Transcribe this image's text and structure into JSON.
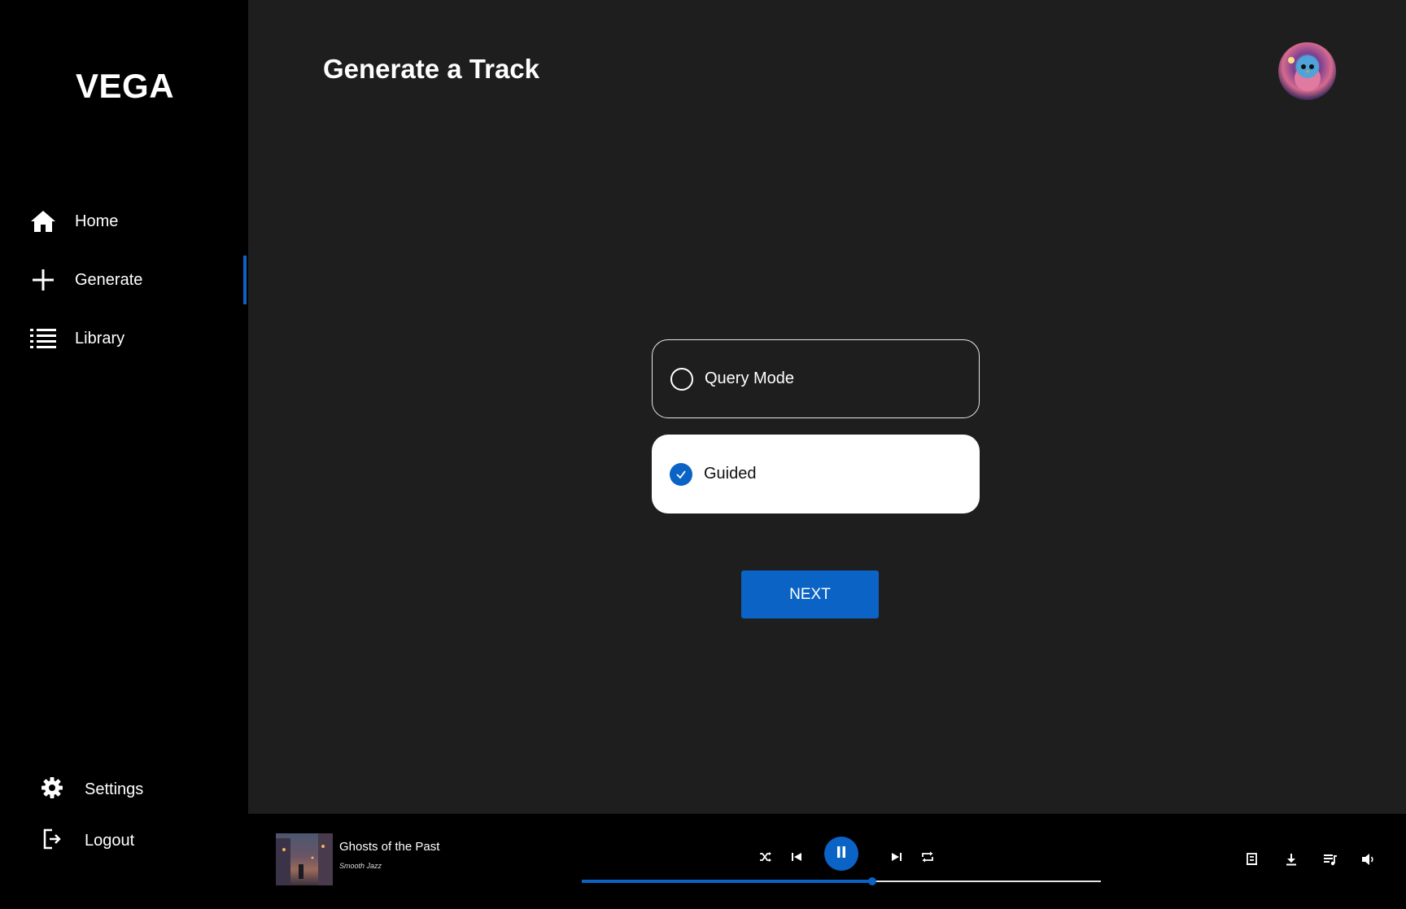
{
  "app": {
    "name": "VEGA"
  },
  "sidebar": {
    "items": [
      {
        "label": "Home",
        "icon": "home-icon"
      },
      {
        "label": "Generate",
        "icon": "plus-icon",
        "active": true
      },
      {
        "label": "Library",
        "icon": "list-icon"
      }
    ],
    "bottom": [
      {
        "label": "Settings",
        "icon": "gear-icon"
      },
      {
        "label": "Logout",
        "icon": "logout-icon"
      }
    ]
  },
  "main": {
    "title": "Generate a Track",
    "options": [
      {
        "label": "Query Mode",
        "selected": false
      },
      {
        "label": "Guided",
        "selected": true
      }
    ],
    "next_label": "NEXT"
  },
  "player": {
    "track_title": "Ghosts of the Past",
    "track_genre": "Smooth Jazz",
    "progress": 0.56,
    "playing": true
  },
  "colors": {
    "accent": "#0b63c5",
    "sidebar_bg": "#000000",
    "main_bg": "#1e1e1f"
  }
}
